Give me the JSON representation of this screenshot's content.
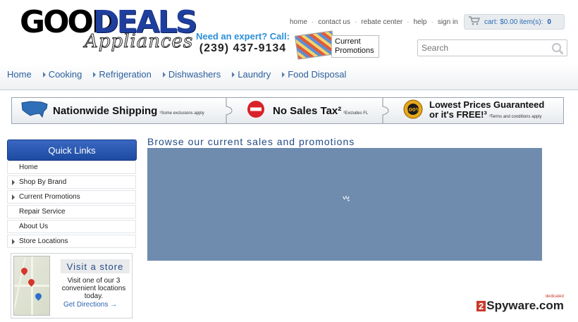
{
  "logo": {
    "word1": "GOOD",
    "word2": "DEALS",
    "word3": "Appliances"
  },
  "top_links": [
    "home",
    "contact us",
    "rebate center",
    "help",
    "sign in"
  ],
  "cart": {
    "label": "cart: $0.00 item(s):",
    "count": "0"
  },
  "expert": {
    "question": "Need an expert? Call:",
    "phone": "(239) 437-9134"
  },
  "promotions_box": {
    "line1": "Current",
    "line2": "Promotions"
  },
  "search": {
    "placeholder": "Search"
  },
  "nav": [
    "Home",
    "Cooking",
    "Refrigeration",
    "Dishwashers",
    "Laundry",
    "Food Disposal"
  ],
  "banner": {
    "shipping": "Nationwide Shipping",
    "shipping_note": "¹Some exclusions apply",
    "tax": "No Sales Tax²",
    "tax_note": "²Excludes FL",
    "price_line1": "Lowest Prices Guaranteed",
    "price_line2": "or it's FREE!³",
    "price_note": "³Terms and conditions apply",
    "badge_text": "100%"
  },
  "quick_links": {
    "title": "Quick Links",
    "items": [
      {
        "label": "Home",
        "expandable": false
      },
      {
        "label": "Shop By Brand",
        "expandable": true
      },
      {
        "label": "Current Promotions",
        "expandable": true
      },
      {
        "label": "Repair Service",
        "expandable": false
      },
      {
        "label": "About Us",
        "expandable": false
      },
      {
        "label": "Store Locations",
        "expandable": true
      }
    ]
  },
  "visit": {
    "title": "Visit a store",
    "text": "Visit one of our 3 convenient locations today.",
    "link": "Get Directions →"
  },
  "main": {
    "title": "Browse our current sales and promotions"
  },
  "watermark": {
    "two": "2",
    "text": "Spyware.com",
    "small": "dedicated"
  },
  "colors": {
    "brand_blue": "#1f3f9e",
    "nav_blue": "#2b5f9e",
    "panel": "#6f8cae",
    "quicklinks": "#2a56b0"
  }
}
